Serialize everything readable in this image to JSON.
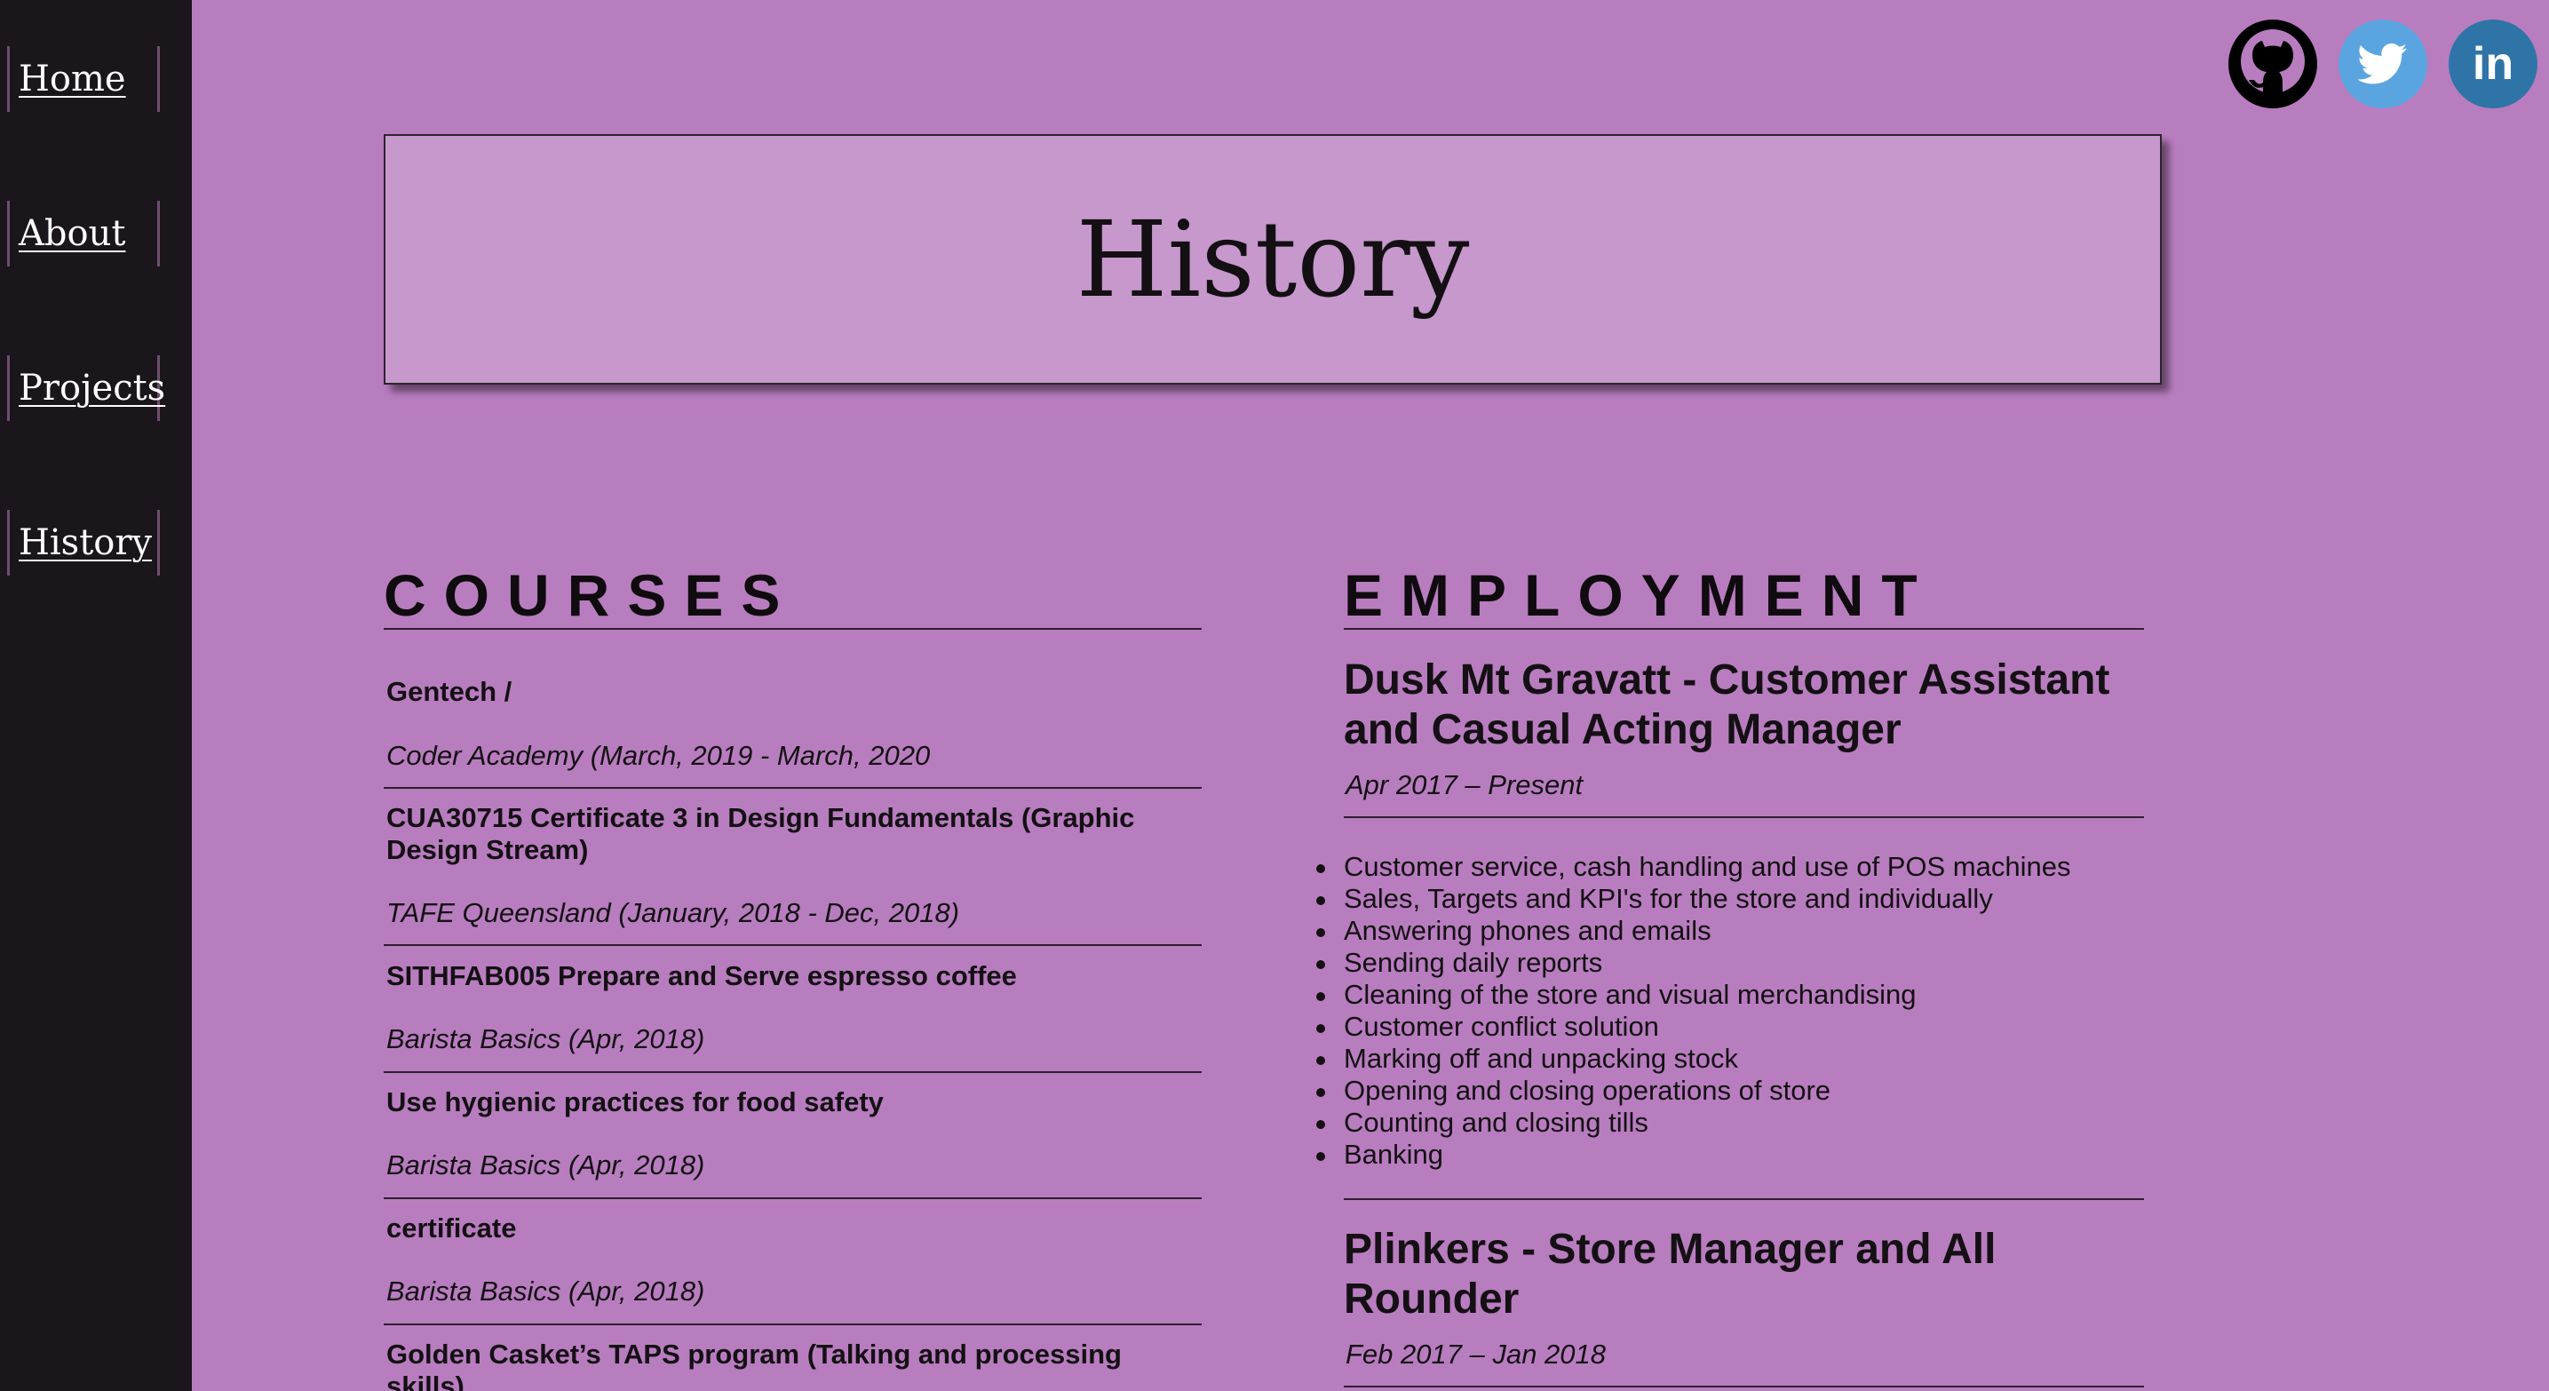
{
  "nav": {
    "items": [
      {
        "label": "Home"
      },
      {
        "label": "About"
      },
      {
        "label": "Projects"
      },
      {
        "label": "History"
      }
    ]
  },
  "social": {
    "github_icon": "github-icon",
    "twitter_icon": "twitter-icon",
    "linkedin_icon": "linkedin-icon",
    "linkedin_text": "in",
    "colors": {
      "github": "#000000",
      "twitter": "#5aa5e0",
      "linkedin": "#2f74a7"
    }
  },
  "page": {
    "title": "History"
  },
  "courses": {
    "heading": "COURSES",
    "items": [
      {
        "title": "Gentech /",
        "subtitle": "Coder Academy (March, 2019 - March, 2020"
      },
      {
        "title": "CUA30715 Certificate 3 in Design Fundamentals (Graphic Design Stream)",
        "subtitle": "TAFE Queensland (January, 2018 - Dec, 2018)"
      },
      {
        "title": "SITHFAB005 Prepare and Serve espresso coffee",
        "subtitle": "Barista Basics (Apr, 2018)"
      },
      {
        "title": "Use hygienic practices for food safety",
        "subtitle": "Barista Basics (Apr, 2018)"
      },
      {
        "title": "certificate",
        "subtitle": "Barista Basics (Apr, 2018)"
      },
      {
        "title": "Golden Casket’s TAPS program (Talking and processing skills)",
        "subtitle": ""
      }
    ]
  },
  "employment": {
    "heading": "EMPLOYMENT",
    "jobs": [
      {
        "title": "Dusk Mt Gravatt - Customer Assistant and Casual Acting Manager",
        "dates": "Apr 2017 – Present",
        "duties": [
          "Customer service, cash handling and use of POS machines",
          "Sales, Targets and KPI's for the store and individually",
          "Answering phones and emails",
          "Sending daily reports",
          "Cleaning of the store and visual merchandising",
          "Customer conflict solution",
          "Marking off and unpacking stock",
          "Opening and closing operations of store",
          "Counting and closing tills",
          "Banking"
        ]
      },
      {
        "title": "Plinkers - Store Manager and All Rounder",
        "dates": "Feb 2017 – Jan 2018"
      }
    ]
  }
}
